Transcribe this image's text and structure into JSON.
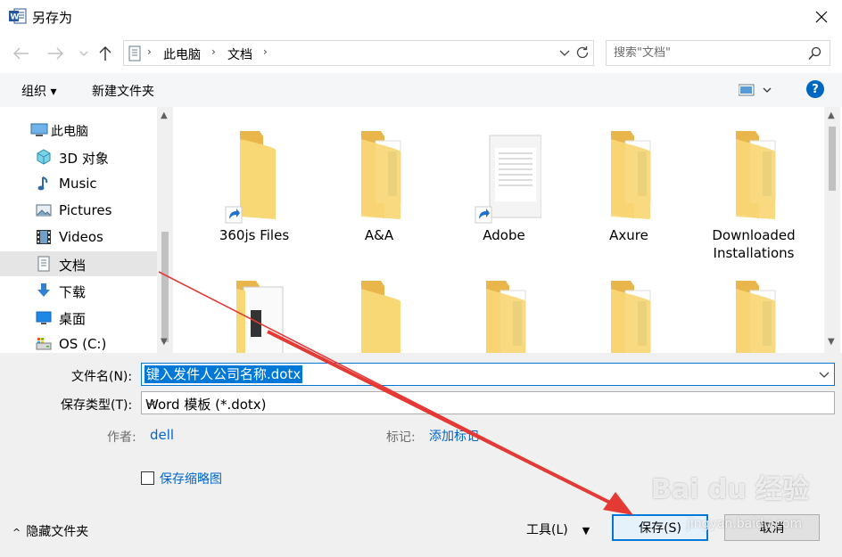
{
  "window": {
    "title": "另存为",
    "app_icon": "word-icon",
    "close_icon": "close-icon"
  },
  "navigation": {
    "back_icon": "back-arrow-icon",
    "forward_icon": "forward-arrow-icon",
    "recent_icon": "chevron-down-icon",
    "up_icon": "up-arrow-icon",
    "breadcrumb": [
      "此电脑",
      "文档"
    ],
    "refresh_icon": "refresh-icon",
    "search_placeholder": "搜索\"文档\""
  },
  "toolbar": {
    "organize": "组织 ▾",
    "new_folder": "新建文件夹",
    "view_icon": "view-options-icon",
    "help": "?"
  },
  "sidebar": {
    "items": [
      {
        "label": "此电脑",
        "icon": "computer-icon"
      },
      {
        "label": "3D 对象",
        "icon": "3d-objects-icon"
      },
      {
        "label": "Music",
        "icon": "music-icon"
      },
      {
        "label": "Pictures",
        "icon": "pictures-icon"
      },
      {
        "label": "Videos",
        "icon": "videos-icon"
      },
      {
        "label": "文档",
        "icon": "documents-icon",
        "selected": true
      },
      {
        "label": "下载",
        "icon": "download-icon"
      },
      {
        "label": "桌面",
        "icon": "desktop-icon"
      },
      {
        "label": "OS (C:)",
        "icon": "drive-icon"
      }
    ]
  },
  "files": [
    {
      "name": "360js Files",
      "type": "folder-shortcut"
    },
    {
      "name": "A&A",
      "type": "folder-docs"
    },
    {
      "name": "Adobe",
      "type": "document-shortcut"
    },
    {
      "name": "Axure",
      "type": "folder-docs"
    },
    {
      "name": "Downloaded Installations",
      "type": "folder-docs"
    },
    {
      "name": "",
      "type": "folder-papers"
    },
    {
      "name": "",
      "type": "folder-plain"
    },
    {
      "name": "",
      "type": "folder-docs"
    },
    {
      "name": "",
      "type": "folder-docs"
    },
    {
      "name": "",
      "type": "folder-docs"
    }
  ],
  "save_form": {
    "filename_label": "文件名(N):",
    "filename_value": "键入发件人公司名称.dotx",
    "type_label": "保存类型(T):",
    "type_value": "Word 模板 (*.dotx)",
    "author_label": "作者:",
    "author_value": "dell",
    "tags_label": "标记:",
    "tags_value": "添加标记",
    "thumbnail_label": "保存缩略图",
    "thumbnail_checked": false
  },
  "footer": {
    "hide_folders": "隐藏文件夹",
    "tools": "工具(L)",
    "save": "保存(S)",
    "cancel": "取消"
  },
  "colors": {
    "accent": "#0078d7",
    "link": "#0066cc",
    "annotation_arrow": "#e53935",
    "folder": "#f8d775"
  },
  "watermark": {
    "brand": "Bai du 经验",
    "url": "jingyan.baidu.com"
  }
}
